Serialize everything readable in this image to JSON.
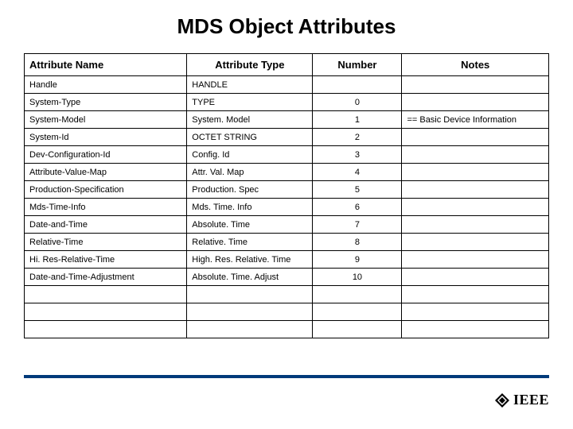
{
  "title": "MDS Object Attributes",
  "columns": {
    "name": "Attribute Name",
    "type": "Attribute Type",
    "number": "Number",
    "notes": "Notes"
  },
  "rows": [
    {
      "name": "Handle",
      "type": "HANDLE",
      "number": "",
      "notes": ""
    },
    {
      "name": "System-Type",
      "type": "TYPE",
      "number": "0",
      "notes": ""
    },
    {
      "name": "System-Model",
      "type": "System. Model",
      "number": "1",
      "notes": "== Basic Device Information"
    },
    {
      "name": "System-Id",
      "type": "OCTET STRING",
      "number": "2",
      "notes": ""
    },
    {
      "name": "Dev-Configuration-Id",
      "type": "Config. Id",
      "number": "3",
      "notes": ""
    },
    {
      "name": "Attribute-Value-Map",
      "type": "Attr. Val. Map",
      "number": "4",
      "notes": ""
    },
    {
      "name": "Production-Specification",
      "type": "Production. Spec",
      "number": "5",
      "notes": ""
    },
    {
      "name": "Mds-Time-Info",
      "type": "Mds. Time. Info",
      "number": "6",
      "notes": ""
    },
    {
      "name": "Date-and-Time",
      "type": "Absolute. Time",
      "number": "7",
      "notes": ""
    },
    {
      "name": "Relative-Time",
      "type": "Relative. Time",
      "number": "8",
      "notes": ""
    },
    {
      "name": "Hi. Res-Relative-Time",
      "type": "High. Res. Relative. Time",
      "number": "9",
      "notes": ""
    },
    {
      "name": "Date-and-Time-Adjustment",
      "type": "Absolute. Time. Adjust",
      "number": "10",
      "notes": ""
    },
    {
      "name": "",
      "type": "",
      "number": "",
      "notes": ""
    },
    {
      "name": "",
      "type": "",
      "number": "",
      "notes": ""
    },
    {
      "name": "",
      "type": "",
      "number": "",
      "notes": ""
    }
  ],
  "logo": {
    "text": "IEEE"
  },
  "colors": {
    "rule": "#003a7a"
  }
}
